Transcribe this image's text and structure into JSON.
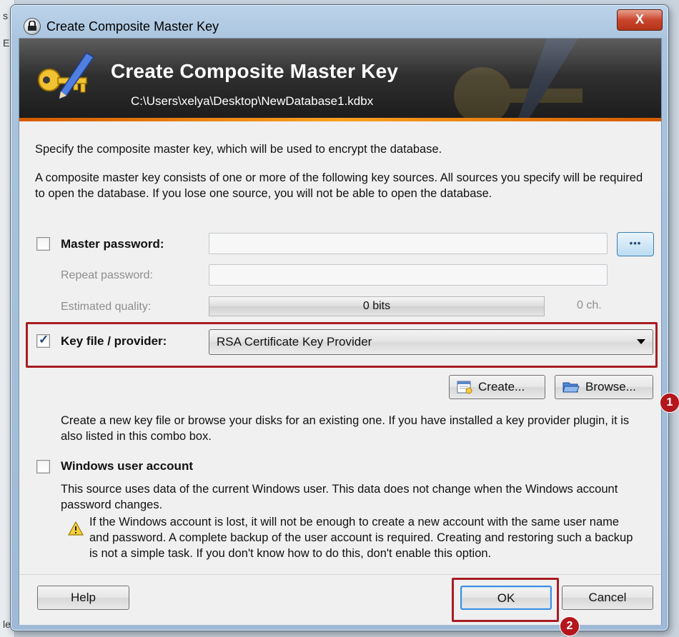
{
  "window": {
    "title": "Create Composite Master Key",
    "close_label": "X"
  },
  "banner": {
    "title": "Create Composite Master Key",
    "path": "C:\\Users\\xelya\\Desktop\\NewDatabase1.kdbx"
  },
  "intro": {
    "line1": "Specify the composite master key, which will be used to encrypt the database.",
    "line2": "A composite master key consists of one or more of the following key sources. All sources you specify will be required to open the database.  If you lose one source, you will not be able to open the database."
  },
  "master_password": {
    "label": "Master password:",
    "checked": false,
    "value": "",
    "toggle_label": "•••",
    "repeat_label": "Repeat password:",
    "repeat_value": "",
    "quality_label": "Estimated quality:",
    "quality_value": "0 bits",
    "quality_chars": "0 ch."
  },
  "key_file": {
    "label": "Key file / provider:",
    "checked": true,
    "selected": "RSA Certificate Key Provider",
    "create_label": "Create...",
    "browse_label": "Browse...",
    "help": "Create a new key file or browse your disks for an existing one. If you have installed a key provider plugin, it is also listed in this combo box."
  },
  "windows_account": {
    "label": "Windows user account",
    "checked": false,
    "info": "This source uses data of the current Windows user. This data does not change when the Windows account password changes.",
    "warning": "If the Windows account is lost, it will not be enough to create a new account with the same user name and password. A complete backup of the user account is required. Creating and restoring such a backup is not a simple task. If you don't know how to do this, don't enable this option."
  },
  "footer": {
    "help_label": "Help",
    "ok_label": "OK",
    "cancel_label": "Cancel"
  },
  "annotations": {
    "marker1": "1",
    "marker2": "2",
    "color": "#b3161c"
  },
  "backdrop": {
    "edge_chars": [
      "s",
      "E",
      "le"
    ]
  },
  "colors": {
    "banner_bg": "#2f2f2f",
    "banner_bar": "#f9a020",
    "highlight": "#a81d22",
    "window_frame": "#a9c4de"
  }
}
